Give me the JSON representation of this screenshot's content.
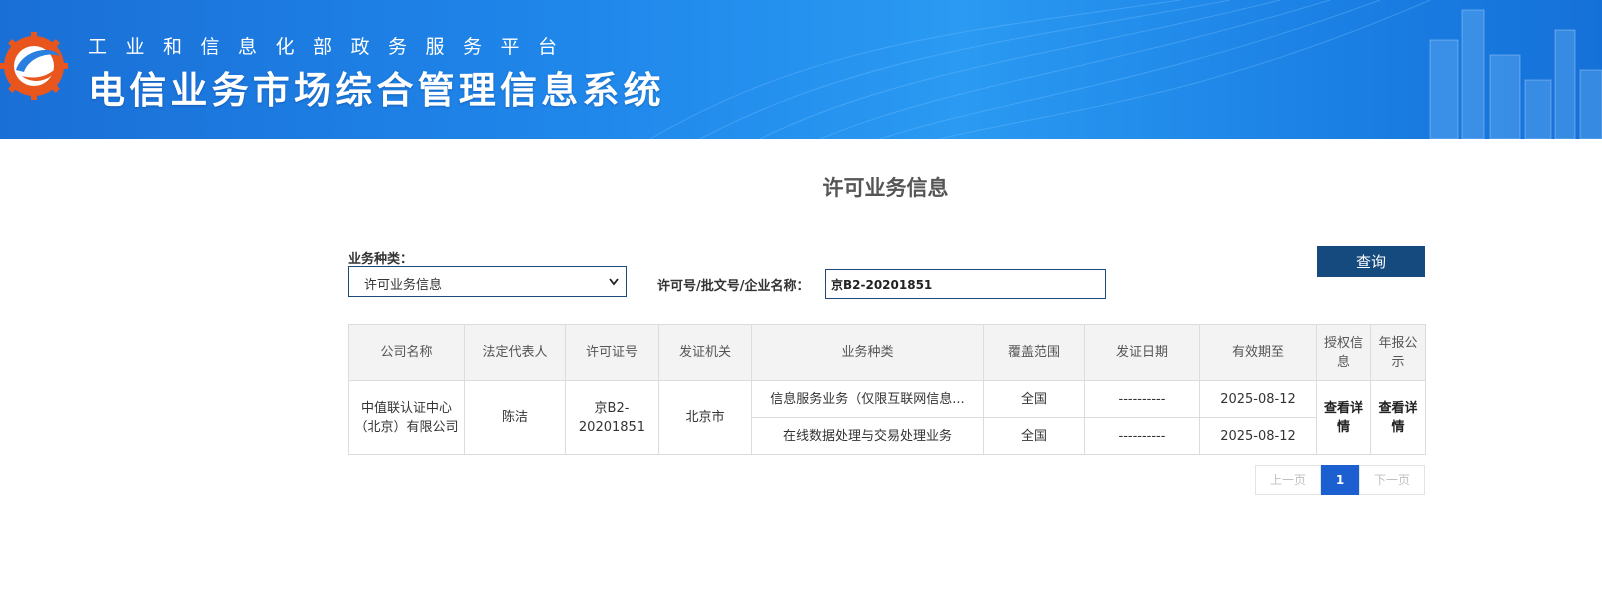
{
  "header": {
    "subtitle": "工业和信息化部政务服务平台",
    "title": "电信业务市场综合管理信息系统"
  },
  "page": {
    "title": "许可业务信息"
  },
  "filters": {
    "type_label": "业务种类：",
    "type_selected": "许可业务信息",
    "query_label": "许可号/批文号/企业名称：",
    "query_value": "京B2-20201851",
    "search_button": "查询"
  },
  "table": {
    "headers": [
      "公司名称",
      "法定代表人",
      "许可证号",
      "发证机关",
      "业务种类",
      "覆盖范围",
      "发证日期",
      "有效期至",
      "授权信息",
      "年报公示"
    ],
    "company": "中值联认证中心（北京）有限公司",
    "representative": "陈洁",
    "license_no": "京B2-20201851",
    "authority": "北京市",
    "businesses": [
      {
        "type": "信息服务业务（仅限互联网信息...",
        "coverage": "全国",
        "issue_date": "----------",
        "valid_until": "2025-08-12"
      },
      {
        "type": "在线数据处理与交易处理业务",
        "coverage": "全国",
        "issue_date": "----------",
        "valid_until": "2025-08-12"
      }
    ],
    "auth_link": "查看详情",
    "annual_link": "查看详情"
  },
  "pagination": {
    "prev": "上一页",
    "current": "1",
    "next": "下一页"
  },
  "colors": {
    "banner": "#1f86ea",
    "button": "#154a7e",
    "page_active": "#1b5fd1"
  }
}
